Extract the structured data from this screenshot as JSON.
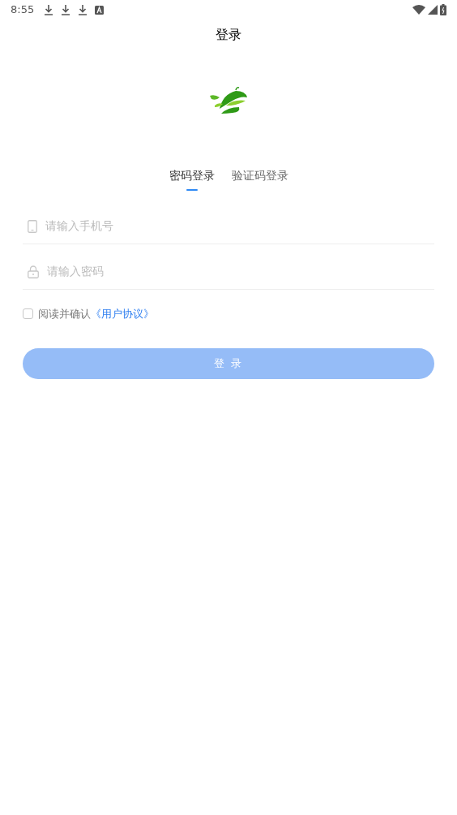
{
  "status_bar": {
    "time": "8:55"
  },
  "title": "登录",
  "tabs": [
    {
      "label": "密码登录",
      "selected": true
    },
    {
      "label": "验证码登录",
      "selected": false
    }
  ],
  "fields": [
    {
      "kind": "phone",
      "placeholder": "请输入手机号"
    },
    {
      "kind": "password",
      "placeholder": "请输入密码"
    }
  ],
  "agreement": {
    "checked": false,
    "text": "阅读并确认",
    "link": "《用户协议》"
  },
  "login_button": {
    "label": "登 录",
    "disabled": true
  }
}
